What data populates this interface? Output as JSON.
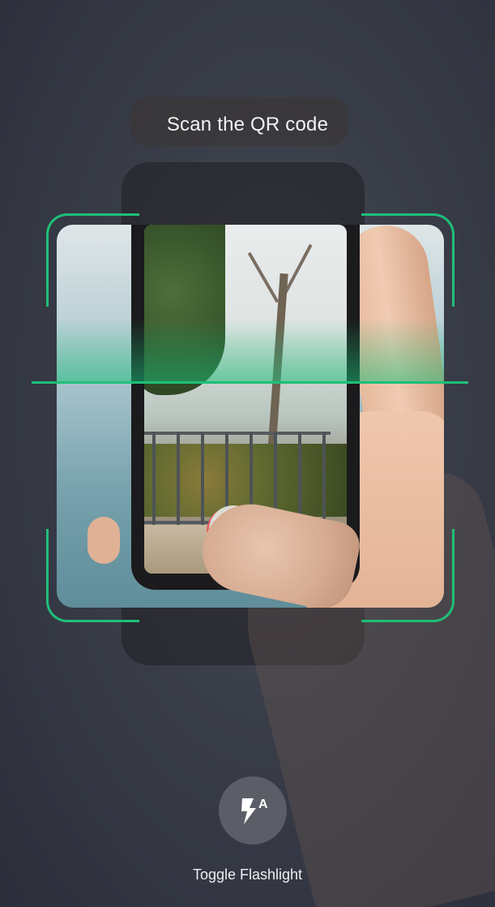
{
  "scanner": {
    "title": "Scan the QR code",
    "frame_color": "#1fbf78"
  },
  "flashlight": {
    "icon": "flash-auto-icon",
    "label": "Toggle Flashlight",
    "auto_letter": "A"
  }
}
